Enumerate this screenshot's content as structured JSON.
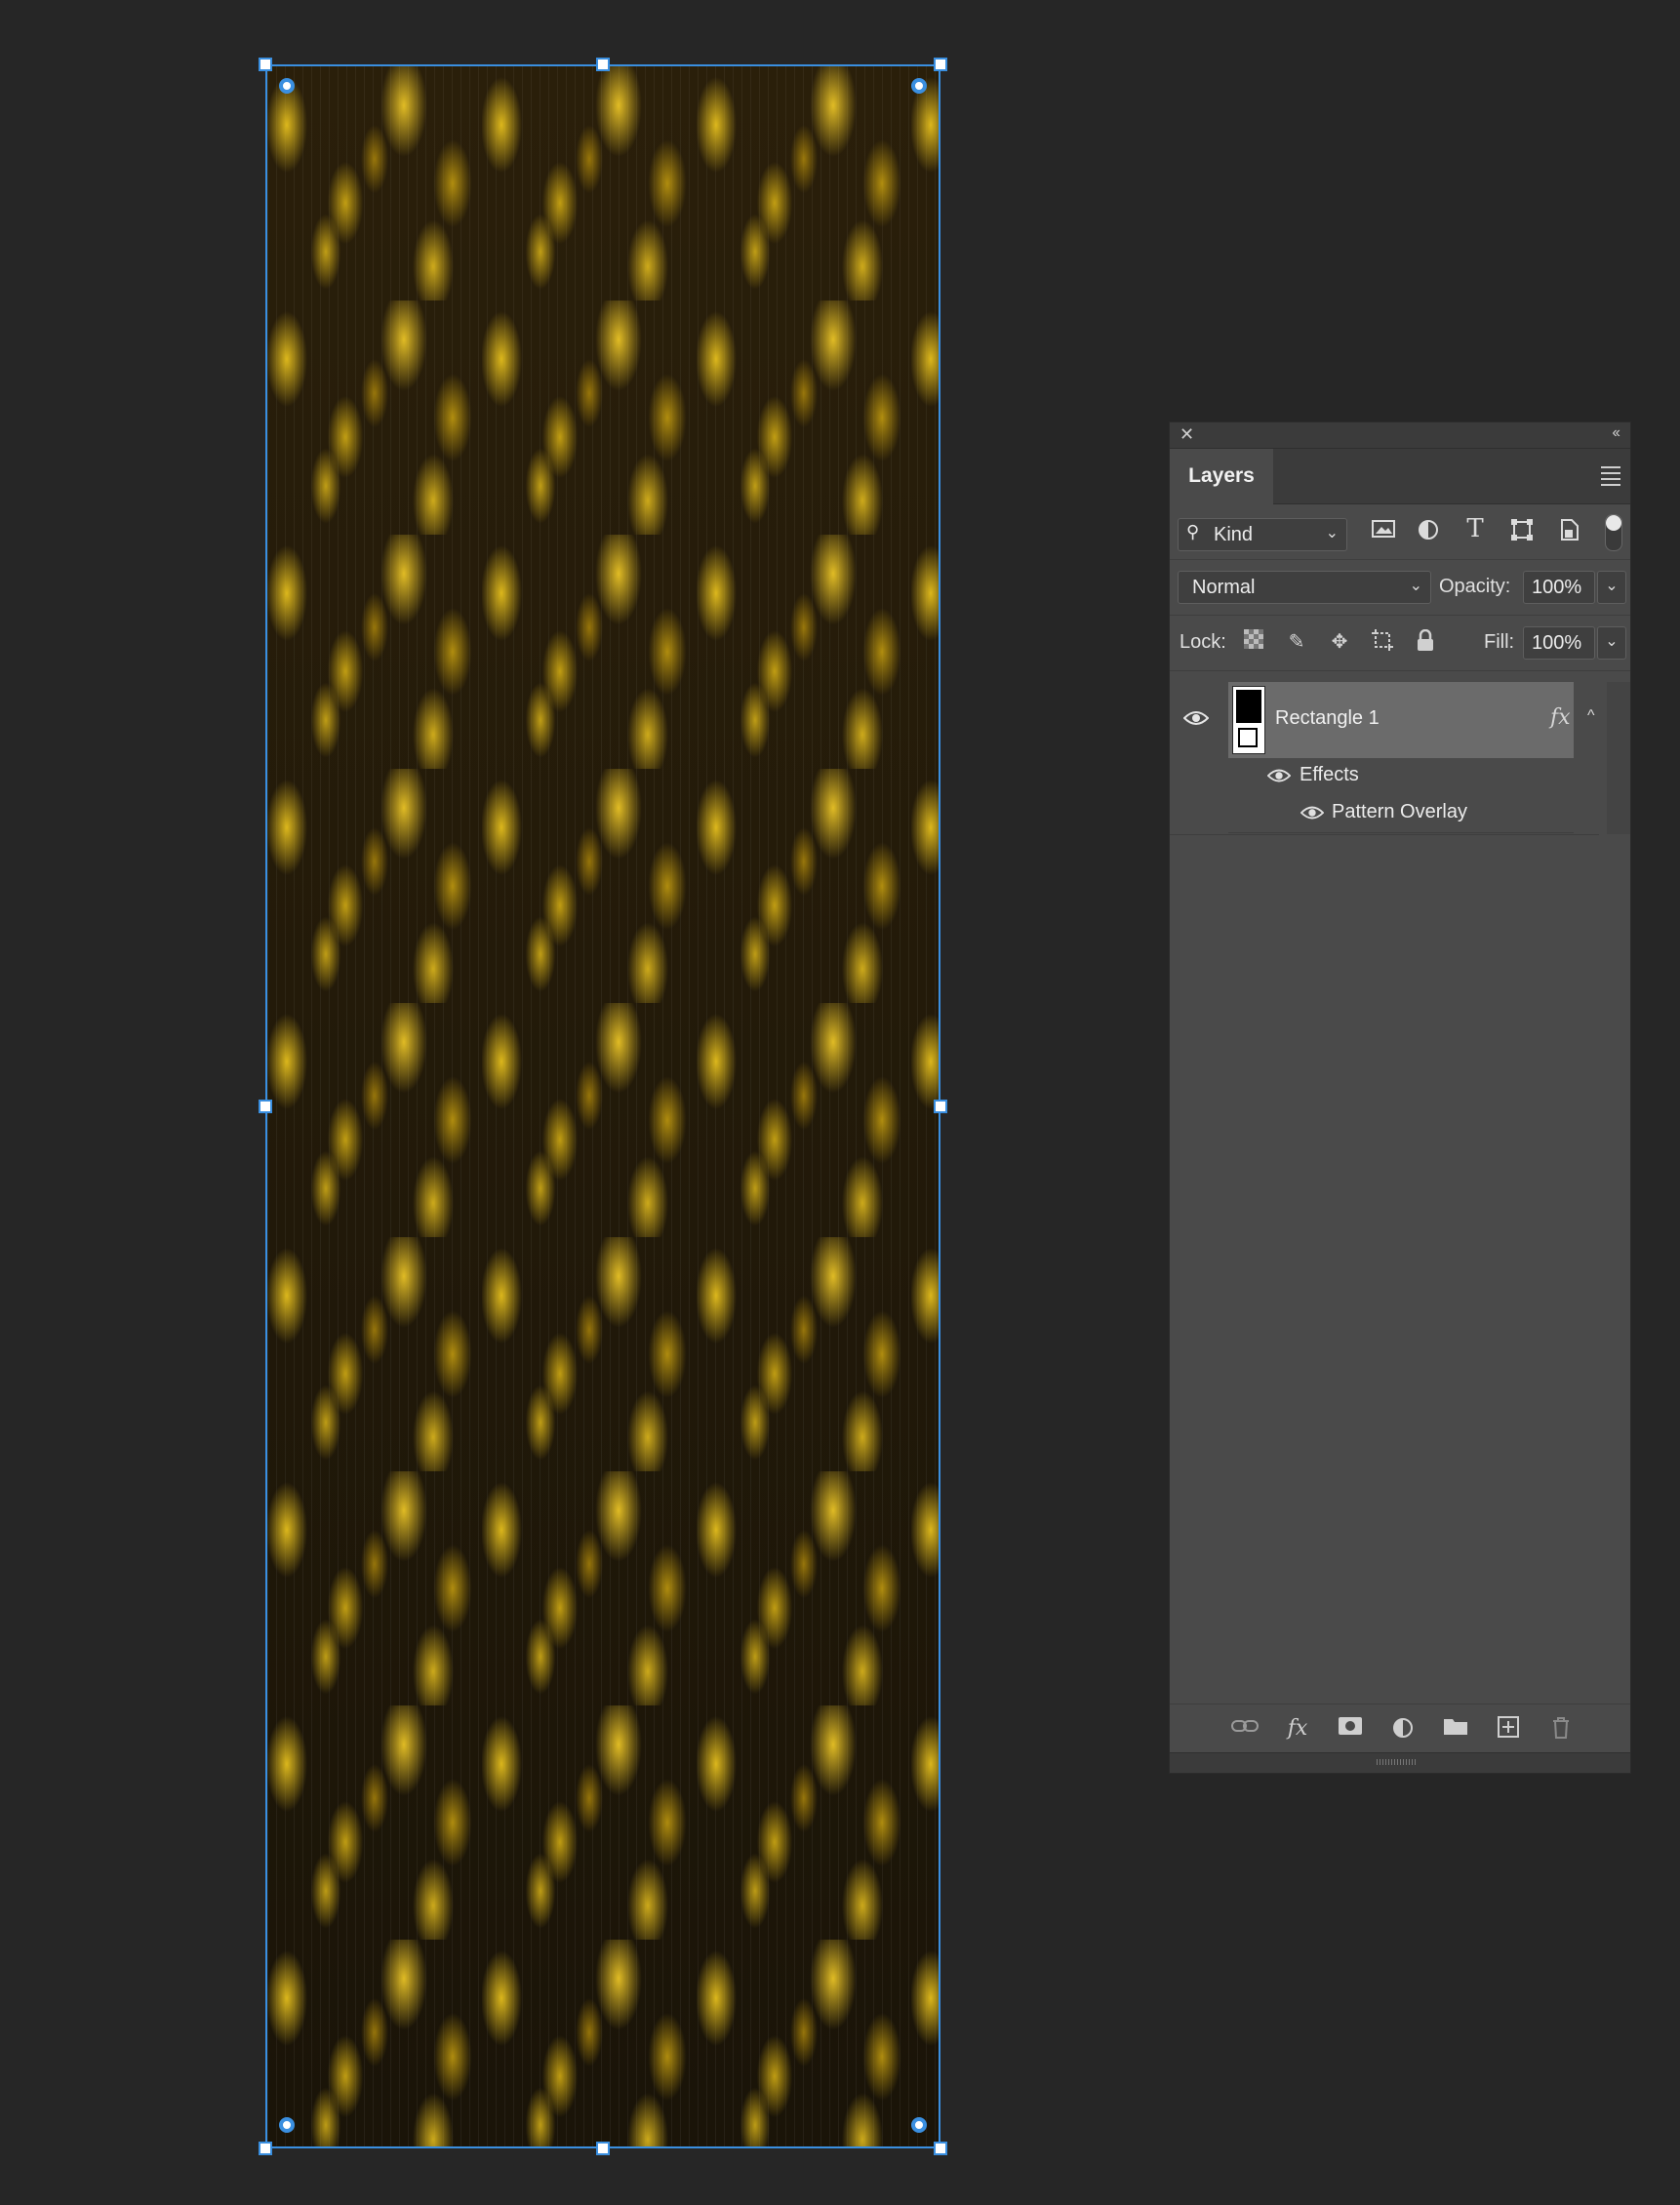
{
  "layers_panel": {
    "tab_label": "Layers",
    "filter": {
      "kind_label": "Kind"
    },
    "blend_mode": "Normal",
    "opacity_label": "Opacity:",
    "opacity_value": "100%",
    "lock_label": "Lock:",
    "fill_label": "Fill:",
    "fill_value": "100%",
    "layers": [
      {
        "name": "Rectangle 1",
        "fx_label": "fx",
        "effects_label": "Effects",
        "effect_items": [
          "Pattern Overlay"
        ]
      }
    ],
    "footer_fx_label": "fx"
  },
  "colors": {
    "selection": "#3a8fe0",
    "panel_bg": "#4a4a4a",
    "workspace_bg": "#262626"
  }
}
